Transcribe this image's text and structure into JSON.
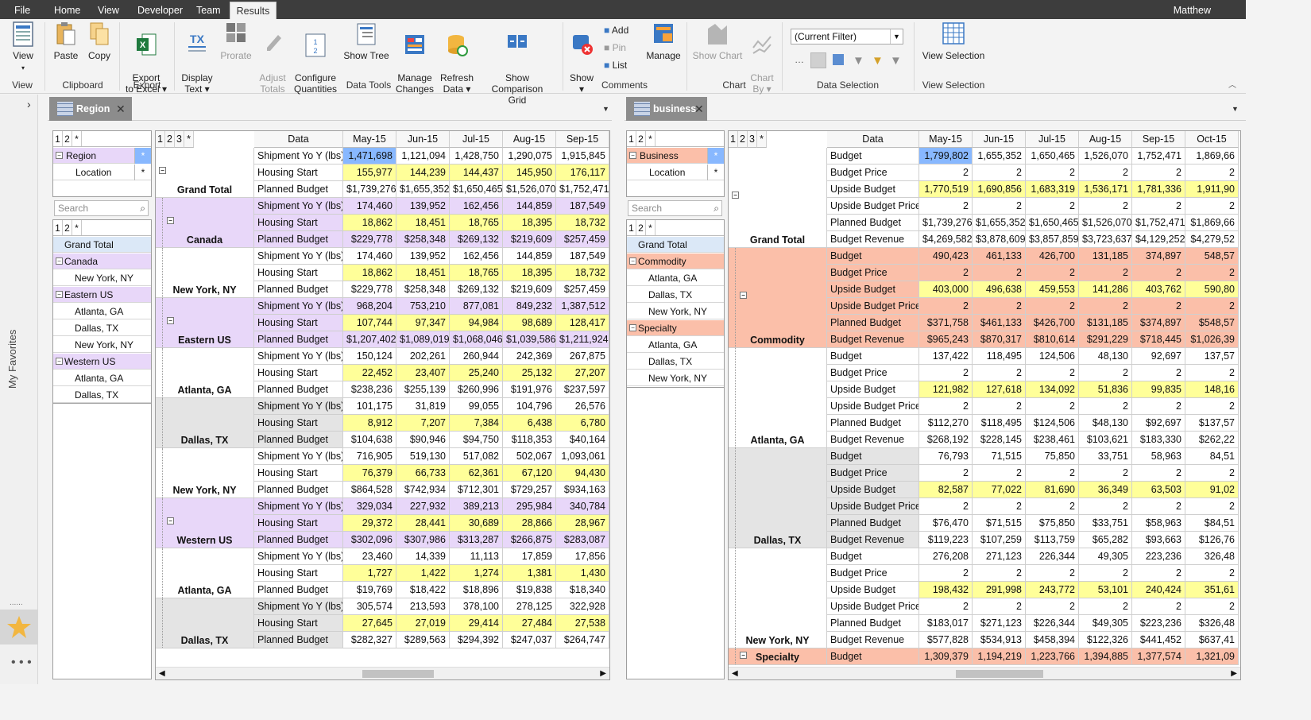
{
  "menubar": {
    "items": [
      "File",
      "Home",
      "View",
      "Developer",
      "Team",
      "Results"
    ],
    "active": "Results",
    "user": "Matthew"
  },
  "ribbon": {
    "buttons": {
      "view": "View",
      "paste": "Paste",
      "copy": "Copy",
      "export": "Export\nto Excel ▾",
      "display_text": "Display\nText ▾",
      "prorate": "Prorate",
      "adjust_totals": "Adjust\nTotals",
      "configure_quantities": "Configure\nQuantities",
      "show_tree": "Show Tree",
      "manage_changes": "Manage\nChanges",
      "refresh_data": "Refresh\nData ▾",
      "show_comparison_grid": "Show Comparison\nGrid",
      "show": "Show\n▾",
      "add": "Add",
      "pin": "Pin",
      "list": "List",
      "manage": "Manage",
      "show_chart": "Show Chart",
      "chart_by": "Chart\nBy ▾",
      "view_selection": "View Selection"
    },
    "groups": {
      "view": "View",
      "clipboard": "Clipboard",
      "export": "Export",
      "data_tools": "Data Tools",
      "comments": "Comments",
      "chart": "Chart",
      "data_selection": "Data Selection",
      "view_selection": "View Selection"
    },
    "filter_value": "(Current Filter)"
  },
  "sidebar": {
    "label": "My Favorites"
  },
  "left": {
    "tab_title": "Region",
    "levels": [
      "1",
      "2",
      "*"
    ],
    "dims": [
      {
        "name": "Region",
        "star": "*"
      },
      {
        "name": "Location",
        "star": "*"
      }
    ],
    "search_placeholder": "Search",
    "tree": [
      {
        "label": "Grand Total",
        "type": "total"
      },
      {
        "label": "Canada",
        "type": "group"
      },
      {
        "label": "New York, NY",
        "type": "leaf"
      },
      {
        "label": "Eastern US",
        "type": "group"
      },
      {
        "label": "Atlanta, GA",
        "type": "leaf"
      },
      {
        "label": "Dallas, TX",
        "type": "leaf"
      },
      {
        "label": "New York, NY",
        "type": "leaf"
      },
      {
        "label": "Western US",
        "type": "group"
      },
      {
        "label": "Atlanta, GA",
        "type": "leaf"
      },
      {
        "label": "Dallas, TX",
        "type": "leaf"
      }
    ],
    "grid": {
      "levels": [
        "1",
        "2",
        "3",
        "*"
      ],
      "data_header": "Data",
      "columns": [
        "May-15",
        "Jun-15",
        "Jul-15",
        "Aug-15",
        "Sep-15"
      ],
      "metrics": [
        "Shipment Yo Y (lbs)",
        "Housing Start",
        "Planned Budget"
      ],
      "groups": [
        {
          "name": "Grand Total",
          "type": "total",
          "rows": [
            [
              "1,471,698",
              "1,121,094",
              "1,428,750",
              "1,290,075",
              "1,915,845"
            ],
            [
              "155,977",
              "144,239",
              "144,437",
              "145,950",
              "176,117"
            ],
            [
              "$1,739,276",
              "$1,655,352",
              "$1,650,465",
              "$1,526,070",
              "$1,752,471"
            ]
          ]
        },
        {
          "name": "Canada",
          "type": "group",
          "rows": [
            [
              "174,460",
              "139,952",
              "162,456",
              "144,859",
              "187,549"
            ],
            [
              "18,862",
              "18,451",
              "18,765",
              "18,395",
              "18,732"
            ],
            [
              "$229,778",
              "$258,348",
              "$269,132",
              "$219,609",
              "$257,459"
            ]
          ]
        },
        {
          "name": "New York, NY",
          "type": "leaf",
          "rows": [
            [
              "174,460",
              "139,952",
              "162,456",
              "144,859",
              "187,549"
            ],
            [
              "18,862",
              "18,451",
              "18,765",
              "18,395",
              "18,732"
            ],
            [
              "$229,778",
              "$258,348",
              "$269,132",
              "$219,609",
              "$257,459"
            ]
          ]
        },
        {
          "name": "Eastern US",
          "type": "group",
          "rows": [
            [
              "968,204",
              "753,210",
              "877,081",
              "849,232",
              "1,387,512"
            ],
            [
              "107,744",
              "97,347",
              "94,984",
              "98,689",
              "128,417"
            ],
            [
              "$1,207,402",
              "$1,089,019",
              "$1,068,046",
              "$1,039,586",
              "$1,211,924"
            ]
          ]
        },
        {
          "name": "Atlanta, GA",
          "type": "leaf",
          "rows": [
            [
              "150,124",
              "202,261",
              "260,944",
              "242,369",
              "267,875"
            ],
            [
              "22,452",
              "23,407",
              "25,240",
              "25,132",
              "27,207"
            ],
            [
              "$238,236",
              "$255,139",
              "$260,996",
              "$191,976",
              "$237,597"
            ]
          ]
        },
        {
          "name": "Dallas, TX",
          "type": "leafgray",
          "rows": [
            [
              "101,175",
              "31,819",
              "99,055",
              "104,796",
              "26,576"
            ],
            [
              "8,912",
              "7,207",
              "7,384",
              "6,438",
              "6,780"
            ],
            [
              "$104,638",
              "$90,946",
              "$94,750",
              "$118,353",
              "$40,164"
            ]
          ]
        },
        {
          "name": "New York, NY",
          "type": "leaf",
          "rows": [
            [
              "716,905",
              "519,130",
              "517,082",
              "502,067",
              "1,093,061"
            ],
            [
              "76,379",
              "66,733",
              "62,361",
              "67,120",
              "94,430"
            ],
            [
              "$864,528",
              "$742,934",
              "$712,301",
              "$729,257",
              "$934,163"
            ]
          ]
        },
        {
          "name": "Western US",
          "type": "group",
          "rows": [
            [
              "329,034",
              "227,932",
              "389,213",
              "295,984",
              "340,784"
            ],
            [
              "29,372",
              "28,441",
              "30,689",
              "28,866",
              "28,967"
            ],
            [
              "$302,096",
              "$307,986",
              "$313,287",
              "$266,875",
              "$283,087"
            ]
          ]
        },
        {
          "name": "Atlanta, GA",
          "type": "leaf",
          "rows": [
            [
              "23,460",
              "14,339",
              "11,113",
              "17,859",
              "17,856"
            ],
            [
              "1,727",
              "1,422",
              "1,274",
              "1,381",
              "1,430"
            ],
            [
              "$19,769",
              "$18,422",
              "$18,896",
              "$19,838",
              "$18,340"
            ]
          ]
        },
        {
          "name": "Dallas, TX",
          "type": "leafgray",
          "rows": [
            [
              "305,574",
              "213,593",
              "378,100",
              "278,125",
              "322,928"
            ],
            [
              "27,645",
              "27,019",
              "29,414",
              "27,484",
              "27,538"
            ],
            [
              "$282,327",
              "$289,563",
              "$294,392",
              "$247,037",
              "$264,747"
            ]
          ]
        }
      ]
    }
  },
  "right": {
    "tab_title": "business",
    "levels": [
      "1",
      "2",
      "*"
    ],
    "dims": [
      {
        "name": "Business",
        "star": "*"
      },
      {
        "name": "Location",
        "star": "*"
      }
    ],
    "search_placeholder": "Search",
    "tree": [
      {
        "label": "Grand Total",
        "type": "total"
      },
      {
        "label": "Commodity",
        "type": "group"
      },
      {
        "label": "Atlanta, GA",
        "type": "leaf"
      },
      {
        "label": "Dallas, TX",
        "type": "leaf"
      },
      {
        "label": "New York, NY",
        "type": "leaf"
      },
      {
        "label": "Specialty",
        "type": "group"
      },
      {
        "label": "Atlanta, GA",
        "type": "leaf"
      },
      {
        "label": "Dallas, TX",
        "type": "leaf"
      },
      {
        "label": "New York, NY",
        "type": "leaf"
      }
    ],
    "grid": {
      "levels": [
        "1",
        "2",
        "3",
        "*"
      ],
      "data_header": "Data",
      "columns": [
        "May-15",
        "Jun-15",
        "Jul-15",
        "Aug-15",
        "Sep-15",
        "Oct-15"
      ],
      "metrics": [
        "Budget",
        "Budget Price",
        "Upside Budget",
        "Upside Budget Price",
        "Planned Budget",
        "Budget Revenue"
      ],
      "groups": [
        {
          "name": "Grand Total",
          "type": "total",
          "rows": [
            [
              "1,799,802",
              "1,655,352",
              "1,650,465",
              "1,526,070",
              "1,752,471",
              "1,869,66"
            ],
            [
              "2",
              "2",
              "2",
              "2",
              "2",
              "2"
            ],
            [
              "1,770,519",
              "1,690,856",
              "1,683,319",
              "1,536,171",
              "1,781,336",
              "1,911,90"
            ],
            [
              "2",
              "2",
              "2",
              "2",
              "2",
              "2"
            ],
            [
              "$1,739,276",
              "$1,655,352",
              "$1,650,465",
              "$1,526,070",
              "$1,752,471",
              "$1,869,66"
            ],
            [
              "$4,269,582",
              "$3,878,609",
              "$3,857,859",
              "$3,723,637",
              "$4,129,252",
              "$4,279,52"
            ]
          ]
        },
        {
          "name": "Commodity",
          "type": "group",
          "rows": [
            [
              "490,423",
              "461,133",
              "426,700",
              "131,185",
              "374,897",
              "548,57"
            ],
            [
              "2",
              "2",
              "2",
              "2",
              "2",
              "2"
            ],
            [
              "403,000",
              "496,638",
              "459,553",
              "141,286",
              "403,762",
              "590,80"
            ],
            [
              "2",
              "2",
              "2",
              "2",
              "2",
              "2"
            ],
            [
              "$371,758",
              "$461,133",
              "$426,700",
              "$131,185",
              "$374,897",
              "$548,57"
            ],
            [
              "$965,243",
              "$870,317",
              "$810,614",
              "$291,229",
              "$718,445",
              "$1,026,39"
            ]
          ]
        },
        {
          "name": "Atlanta, GA",
          "type": "leaf",
          "rows": [
            [
              "137,422",
              "118,495",
              "124,506",
              "48,130",
              "92,697",
              "137,57"
            ],
            [
              "2",
              "2",
              "2",
              "2",
              "2",
              "2"
            ],
            [
              "121,982",
              "127,618",
              "134,092",
              "51,836",
              "99,835",
              "148,16"
            ],
            [
              "2",
              "2",
              "2",
              "2",
              "2",
              "2"
            ],
            [
              "$112,270",
              "$118,495",
              "$124,506",
              "$48,130",
              "$92,697",
              "$137,57"
            ],
            [
              "$268,192",
              "$228,145",
              "$238,461",
              "$103,621",
              "$183,330",
              "$262,22"
            ]
          ]
        },
        {
          "name": "Dallas, TX",
          "type": "leafgray",
          "rows": [
            [
              "76,793",
              "71,515",
              "75,850",
              "33,751",
              "58,963",
              "84,51"
            ],
            [
              "2",
              "2",
              "2",
              "2",
              "2",
              "2"
            ],
            [
              "82,587",
              "77,022",
              "81,690",
              "36,349",
              "63,503",
              "91,02"
            ],
            [
              "2",
              "2",
              "2",
              "2",
              "2",
              "2"
            ],
            [
              "$76,470",
              "$71,515",
              "$75,850",
              "$33,751",
              "$58,963",
              "$84,51"
            ],
            [
              "$119,223",
              "$107,259",
              "$113,759",
              "$65,282",
              "$93,663",
              "$126,76"
            ]
          ]
        },
        {
          "name": "New York, NY",
          "type": "leaf",
          "rows": [
            [
              "276,208",
              "271,123",
              "226,344",
              "49,305",
              "223,236",
              "326,48"
            ],
            [
              "2",
              "2",
              "2",
              "2",
              "2",
              "2"
            ],
            [
              "198,432",
              "291,998",
              "243,772",
              "53,101",
              "240,424",
              "351,61"
            ],
            [
              "2",
              "2",
              "2",
              "2",
              "2",
              "2"
            ],
            [
              "$183,017",
              "$271,123",
              "$226,344",
              "$49,305",
              "$223,236",
              "$326,48"
            ],
            [
              "$577,828",
              "$534,913",
              "$458,394",
              "$122,326",
              "$441,452",
              "$637,41"
            ]
          ]
        },
        {
          "name": "Specialty",
          "type": "group",
          "rows": [
            [
              "1,309,379",
              "1,194,219",
              "1,223,766",
              "1,394,885",
              "1,377,574",
              "1,321,09"
            ]
          ]
        }
      ]
    }
  },
  "colors": {
    "left_group": "#e8d7f9",
    "right_group": "#fbbfa9",
    "yellow": "#ffff99",
    "selected": "#88b8ff",
    "gray_group": "#e4e4e4"
  }
}
